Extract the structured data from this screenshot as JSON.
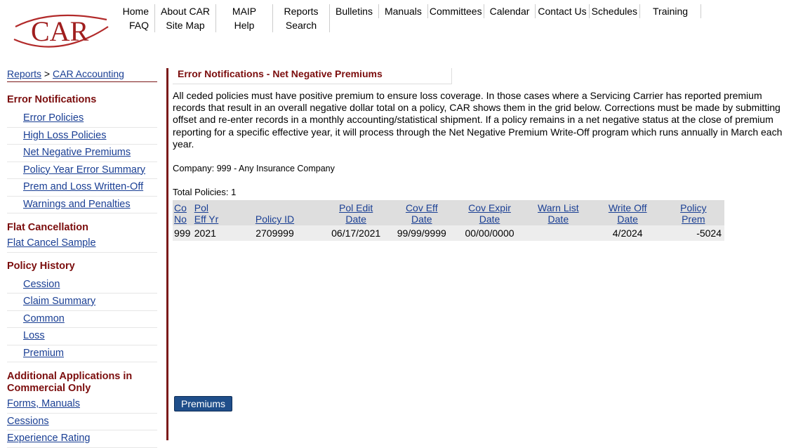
{
  "logo": {
    "text": "CAR"
  },
  "nav_row1": [
    "Home",
    "About CAR",
    "MAIP",
    "Reports",
    "Bulletins",
    "Manuals",
    "Committees",
    "Calendar",
    "Contact Us",
    "Schedules",
    "Training"
  ],
  "nav_row2": [
    "FAQ",
    "Site Map",
    "Help",
    "Search"
  ],
  "breadcrumb": {
    "root": "Reports",
    "sep": ">",
    "current": "CAR Accounting"
  },
  "sidebar": {
    "error_title": "Error Notifications",
    "error_items": [
      "Error Policies",
      "High Loss Policies",
      "Net Negative Premiums",
      "Policy Year Error Summary",
      "Prem and Loss Written-Off",
      "Warnings and Penalties"
    ],
    "flat_title": "Flat Cancellation",
    "flat_items": [
      "Flat Cancel Sample"
    ],
    "history_title": "Policy History",
    "history_items": [
      "Cession",
      "Claim Summary",
      "Common",
      "Loss",
      "Premium"
    ],
    "additional_title": "Additional Applications in Commercial Only",
    "additional_items": [
      "Forms, Manuals",
      "Cessions",
      "Experience Rating"
    ]
  },
  "main": {
    "title": "Error Notifications - Net Negative Premiums",
    "description": "All ceded policies must have positive premium to ensure loss coverage.  In those cases where a Servicing Carrier has reported premium records that result in an overall negative dollar total on a policy, CAR shows them in the grid below.  Corrections must be made by submitting offset and re-enter records in a monthly accounting/statistical shipment.  If a policy remains in a net negative status at the close of premium reporting for a specific effective year, it will process through the Net Negative Premium Write-Off program which runs annually in March each year.",
    "company_label": "Company:",
    "company_value": "999 - Any Insurance Company",
    "total_label": "Total Policies: 1"
  },
  "grid": {
    "headers": [
      [
        "Co",
        "No"
      ],
      [
        "Pol",
        "Eff Yr"
      ],
      [
        "Policy ID",
        ""
      ],
      [
        "Pol Edit",
        "Date"
      ],
      [
        "Cov Eff",
        "Date"
      ],
      [
        "Cov Expir",
        "Date"
      ],
      [
        "Warn List",
        "Date"
      ],
      [
        "Write Off",
        "Date"
      ],
      [
        "Policy",
        "Prem"
      ]
    ],
    "rows": [
      [
        "999",
        "2021",
        "2709999",
        "06/17/2021",
        "99/99/9999",
        "00/00/0000",
        "",
        "4/2024",
        "-5024"
      ]
    ]
  },
  "button": {
    "label": "Premiums"
  },
  "colors": {
    "link": "#1a3f94",
    "accent": "#7b0d0d",
    "button": "#1f4e8a"
  }
}
